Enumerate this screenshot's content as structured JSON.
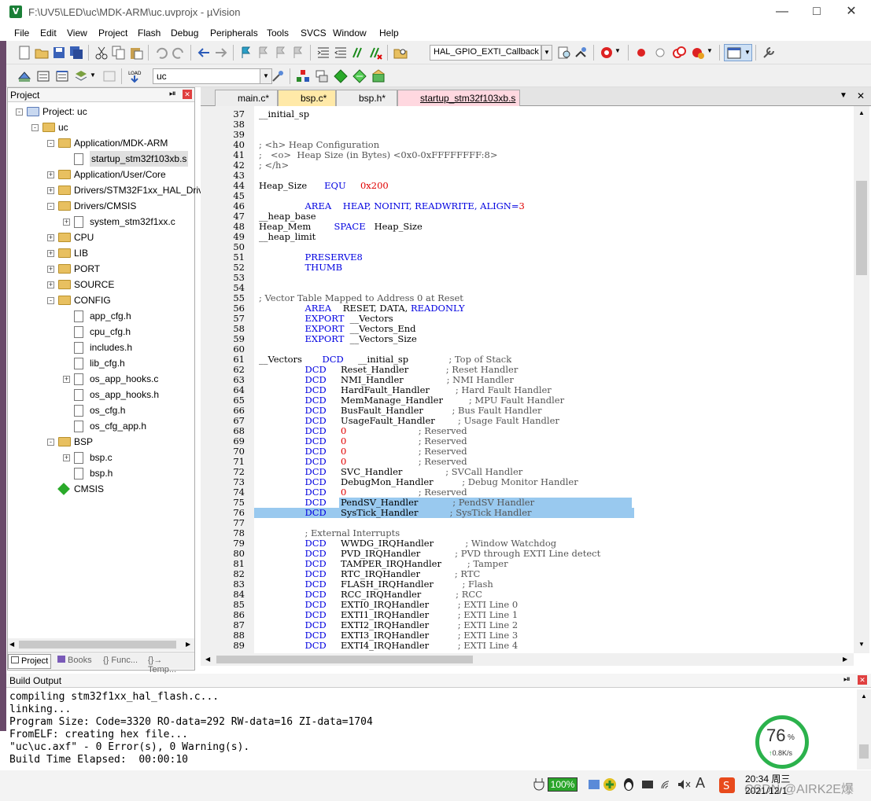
{
  "window": {
    "title": "F:\\UV5\\LED\\uc\\MDK-ARM\\uc.uvprojx - µVision",
    "app_icon": "V"
  },
  "menu": [
    "File",
    "Edit",
    "View",
    "Project",
    "Flash",
    "Debug",
    "Peripherals",
    "Tools",
    "SVCS",
    "Window",
    "Help"
  ],
  "toolbar": {
    "function_combo": "HAL_GPIO_EXTI_Callback",
    "target_combo": "uc"
  },
  "project_panel": {
    "title": "Project",
    "tree": [
      {
        "label": "Project: uc",
        "level": 0,
        "type": "project",
        "expander": "-"
      },
      {
        "label": "uc",
        "level": 1,
        "type": "folder",
        "expander": "-"
      },
      {
        "label": "Application/MDK-ARM",
        "level": 2,
        "type": "folder",
        "expander": "-"
      },
      {
        "label": "startup_stm32f103xb.s",
        "level": 3,
        "type": "file",
        "selected": true
      },
      {
        "label": "Application/User/Core",
        "level": 2,
        "type": "folder",
        "expander": "+"
      },
      {
        "label": "Drivers/STM32F1xx_HAL_Driv",
        "level": 2,
        "type": "folder",
        "expander": "+"
      },
      {
        "label": "Drivers/CMSIS",
        "level": 2,
        "type": "folder",
        "expander": "-"
      },
      {
        "label": "system_stm32f1xx.c",
        "level": 3,
        "type": "file",
        "expander": "+"
      },
      {
        "label": "CPU",
        "level": 2,
        "type": "folder",
        "expander": "+"
      },
      {
        "label": "LIB",
        "level": 2,
        "type": "folder",
        "expander": "+"
      },
      {
        "label": "PORT",
        "level": 2,
        "type": "folder",
        "expander": "+"
      },
      {
        "label": "SOURCE",
        "level": 2,
        "type": "folder",
        "expander": "+"
      },
      {
        "label": "CONFIG",
        "level": 2,
        "type": "folder",
        "expander": "-"
      },
      {
        "label": "app_cfg.h",
        "level": 3,
        "type": "file"
      },
      {
        "label": "cpu_cfg.h",
        "level": 3,
        "type": "file"
      },
      {
        "label": "includes.h",
        "level": 3,
        "type": "file"
      },
      {
        "label": "lib_cfg.h",
        "level": 3,
        "type": "file"
      },
      {
        "label": "os_app_hooks.c",
        "level": 3,
        "type": "file",
        "expander": "+"
      },
      {
        "label": "os_app_hooks.h",
        "level": 3,
        "type": "file"
      },
      {
        "label": "os_cfg.h",
        "level": 3,
        "type": "file"
      },
      {
        "label": "os_cfg_app.h",
        "level": 3,
        "type": "file"
      },
      {
        "label": "BSP",
        "level": 2,
        "type": "folder",
        "expander": "-"
      },
      {
        "label": "bsp.c",
        "level": 3,
        "type": "file",
        "expander": "+"
      },
      {
        "label": "bsp.h",
        "level": 3,
        "type": "file"
      },
      {
        "label": "CMSIS",
        "level": 2,
        "type": "cmsis"
      }
    ],
    "tabs": [
      "Project",
      "Books",
      "{} Func...",
      "{}→ Temp..."
    ]
  },
  "editor": {
    "tabs": [
      {
        "label": "main.c*",
        "active": false
      },
      {
        "label": "bsp.c*",
        "active": false
      },
      {
        "label": "bsp.h*",
        "active": false
      },
      {
        "label": "startup_stm32f103xb.s",
        "active": true
      }
    ],
    "lines": [
      {
        "n": 37,
        "t": "__initial_sp"
      },
      {
        "n": 38,
        "t": ""
      },
      {
        "n": 39,
        "t": ""
      },
      {
        "n": 40,
        "t": "; <h> Heap Configuration",
        "c": "cm"
      },
      {
        "n": 41,
        "t": ";   <o>  Heap Size (in Bytes) <0x0-0xFFFFFFFF:8>",
        "c": "cm"
      },
      {
        "n": 42,
        "t": "; </h>",
        "c": "cm"
      },
      {
        "n": 43,
        "t": ""
      },
      {
        "n": 44,
        "t": "Heap_Size      ",
        "k": "EQU",
        "r": "     ",
        "v": "0x200"
      },
      {
        "n": 45,
        "t": ""
      },
      {
        "n": 46,
        "t": "                ",
        "k": "AREA    HEAP, NOINIT, READWRITE, ALIGN=",
        "v": "3"
      },
      {
        "n": 47,
        "t": "__heap_base"
      },
      {
        "n": 48,
        "t": "Heap_Mem        ",
        "k": "SPACE",
        "r": "   Heap_Size"
      },
      {
        "n": 49,
        "t": "__heap_limit"
      },
      {
        "n": 50,
        "t": ""
      },
      {
        "n": 51,
        "t": "                ",
        "k": "PRESERVE8"
      },
      {
        "n": 52,
        "t": "                ",
        "k": "THUMB"
      },
      {
        "n": 53,
        "t": ""
      },
      {
        "n": 54,
        "t": ""
      },
      {
        "n": 55,
        "t": "; Vector Table Mapped to Address 0 at Reset",
        "c": "cm"
      },
      {
        "n": 56,
        "t": "                ",
        "k": "AREA",
        "r": "    RESET, DATA, ",
        "k2": "READONLY"
      },
      {
        "n": 57,
        "t": "                ",
        "k": "EXPORT",
        "r": "  __Vectors"
      },
      {
        "n": 58,
        "t": "                ",
        "k": "EXPORT",
        "r": "  __Vectors_End"
      },
      {
        "n": 59,
        "t": "                ",
        "k": "EXPORT",
        "r": "  __Vectors_Size"
      },
      {
        "n": 60,
        "t": ""
      },
      {
        "n": 61,
        "t": "__Vectors       ",
        "k": "DCD",
        "r": "     __initial_sp              ",
        "cmt": "; Top of Stack"
      },
      {
        "n": 62,
        "t": "                ",
        "k": "DCD",
        "r": "     Reset_Handler             ",
        "cmt": "; Reset Handler"
      },
      {
        "n": 63,
        "t": "                ",
        "k": "DCD",
        "r": "     NMI_Handler               ",
        "cmt": "; NMI Handler"
      },
      {
        "n": 64,
        "t": "                ",
        "k": "DCD",
        "r": "     HardFault_Handler         ",
        "cmt": "; Hard Fault Handler"
      },
      {
        "n": 65,
        "t": "                ",
        "k": "DCD",
        "r": "     MemManage_Handler         ",
        "cmt": "; MPU Fault Handler"
      },
      {
        "n": 66,
        "t": "                ",
        "k": "DCD",
        "r": "     BusFault_Handler          ",
        "cmt": "; Bus Fault Handler"
      },
      {
        "n": 67,
        "t": "                ",
        "k": "DCD",
        "r": "     UsageFault_Handler        ",
        "cmt": "; Usage Fault Handler"
      },
      {
        "n": 68,
        "t": "                ",
        "k": "DCD",
        "r": "     ",
        "v": "0",
        "r2": "                         ",
        "cmt": "; Reserved"
      },
      {
        "n": 69,
        "t": "                ",
        "k": "DCD",
        "r": "     ",
        "v": "0",
        "r2": "                         ",
        "cmt": "; Reserved"
      },
      {
        "n": 70,
        "t": "                ",
        "k": "DCD",
        "r": "     ",
        "v": "0",
        "r2": "                         ",
        "cmt": "; Reserved"
      },
      {
        "n": 71,
        "t": "                ",
        "k": "DCD",
        "r": "     ",
        "v": "0",
        "r2": "                         ",
        "cmt": "; Reserved"
      },
      {
        "n": 72,
        "t": "                ",
        "k": "DCD",
        "r": "     SVC_Handler               ",
        "cmt": "; SVCall Handler"
      },
      {
        "n": 73,
        "t": "                ",
        "k": "DCD",
        "r": "     DebugMon_Handler          ",
        "cmt": "; Debug Monitor Handler"
      },
      {
        "n": 74,
        "t": "                ",
        "k": "DCD",
        "r": "     ",
        "v": "0",
        "r2": "                         ",
        "cmt": "; Reserved"
      },
      {
        "n": 75,
        "t": "                ",
        "k": "DCD",
        "r": "     PendSV_Handler            ",
        "cmt": "; PendSV Handler",
        "sel": "partial"
      },
      {
        "n": 76,
        "t": "                ",
        "k": "DCD",
        "r": "     SysTick_Handler           ",
        "cmt": "; SysTick Handler",
        "sel": "full"
      },
      {
        "n": 77,
        "t": ""
      },
      {
        "n": 78,
        "t": "                ",
        "cmt": "; External Interrupts"
      },
      {
        "n": 79,
        "t": "                ",
        "k": "DCD",
        "r": "     WWDG_IRQHandler           ",
        "cmt": "; Window Watchdog"
      },
      {
        "n": 80,
        "t": "                ",
        "k": "DCD",
        "r": "     PVD_IRQHandler            ",
        "cmt": "; PVD through EXTI Line detect"
      },
      {
        "n": 81,
        "t": "                ",
        "k": "DCD",
        "r": "     TAMPER_IRQHandler         ",
        "cmt": "; Tamper"
      },
      {
        "n": 82,
        "t": "                ",
        "k": "DCD",
        "r": "     RTC_IRQHandler            ",
        "cmt": "; RTC"
      },
      {
        "n": 83,
        "t": "                ",
        "k": "DCD",
        "r": "     FLASH_IRQHandler          ",
        "cmt": "; Flash"
      },
      {
        "n": 84,
        "t": "                ",
        "k": "DCD",
        "r": "     RCC_IRQHandler            ",
        "cmt": "; RCC"
      },
      {
        "n": 85,
        "t": "                ",
        "k": "DCD",
        "r": "     EXTI0_IRQHandler          ",
        "cmt": "; EXTI Line 0"
      },
      {
        "n": 86,
        "t": "                ",
        "k": "DCD",
        "r": "     EXTI1_IRQHandler          ",
        "cmt": "; EXTI Line 1"
      },
      {
        "n": 87,
        "t": "                ",
        "k": "DCD",
        "r": "     EXTI2_IRQHandler          ",
        "cmt": "; EXTI Line 2"
      },
      {
        "n": 88,
        "t": "                ",
        "k": "DCD",
        "r": "     EXTI3_IRQHandler          ",
        "cmt": "; EXTI Line 3"
      },
      {
        "n": 89,
        "t": "                ",
        "k": "DCD",
        "r": "     EXTI4_IRQHandler          ",
        "cmt": "; EXTI Line 4"
      }
    ]
  },
  "build_output": {
    "title": "Build Output",
    "lines": [
      "compiling stm32f1xx_hal_flash.c...",
      "linking...",
      "Program Size: Code=3320 RO-data=292 RW-data=16 ZI-data=1704",
      "FromELF: creating hex file...",
      "\"uc\\uc.axf\" - 0 Error(s), 0 Warning(s).",
      "Build Time Elapsed:  00:00:10"
    ]
  },
  "speed_widget": {
    "percent": "76",
    "unit": "%",
    "rate": "0.8K/s"
  },
  "taskbar": {
    "battery": "100%",
    "time": "20:34 周三",
    "date": "2021/12/1",
    "watermark": "CSDN @AIRK2E爆"
  },
  "colors": {
    "keyword": "#0000e0",
    "number": "#e00000",
    "selection": "#99c9ef",
    "active_tab": "#ffe9a8"
  }
}
